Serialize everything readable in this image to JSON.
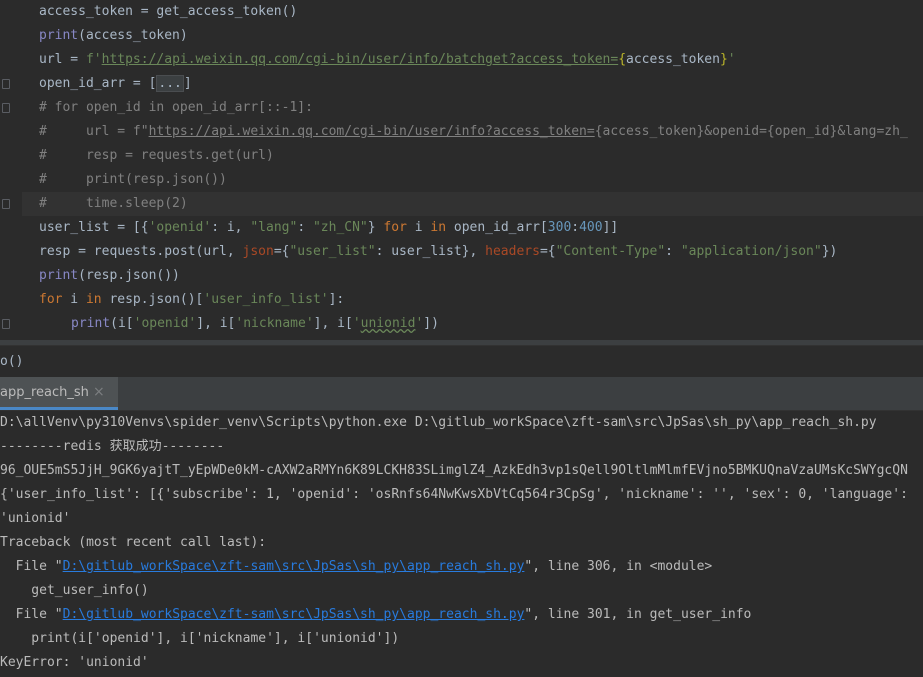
{
  "editor": {
    "line1": "access_token = get_access_token()",
    "line2": {
      "fn": "print",
      "rest": "(access_token)"
    },
    "line3": {
      "lhs": "url = ",
      "prefix": "f'",
      "url": "https://api.weixin.qq.com/cgi-bin/user/info/batchget?access_token=",
      "brace_open": "{",
      "var": "access_token",
      "brace_close": "}",
      "quote": "'"
    },
    "line4": {
      "lhs": "open_id_arr = [",
      "folded": "...",
      "rhs": "]"
    },
    "line5": "# for open_id in open_id_arr[::-1]:",
    "line6": {
      "hash": "#     url = f\"",
      "url": "https://api.weixin.qq.com/cgi-bin/user/info?access_token=",
      "rest": "{access_token}&openid={open_id}&lang=zh_"
    },
    "line7": "#     resp = requests.get(url)",
    "line8": "#     print(resp.json())",
    "line9": "#     time.sleep(2)",
    "line10": {
      "a": "user_list = [{",
      "k1": "'openid'",
      "b": ": i, ",
      "k2": "\"lang\"",
      "c": ": ",
      "v2": "\"zh_CN\"",
      "d": "} ",
      "for": "for",
      "e": " i ",
      "in": "in",
      "f": " open_id_arr[",
      "n1": "300",
      "g": ":",
      "n2": "400",
      "h": "]]"
    },
    "line11": {
      "a": "resp = requests.post(url, ",
      "p1": "json",
      "b": "={",
      "s1": "\"user_list\"",
      "c": ": user_list}, ",
      "p2": "headers",
      "d": "={",
      "s2": "\"Content-Type\"",
      "e": ": ",
      "s3": "\"application/json\"",
      "f": "})"
    },
    "line12": {
      "fn": "print",
      "rest": "(resp.json())"
    },
    "line13": {
      "for": "for",
      "a": " i ",
      "in": "in",
      "b": " resp.json()[",
      "s": "'user_info_list'",
      "c": "]:"
    },
    "line14": {
      "fn": "print",
      "a": "(i[",
      "s1": "'openid'",
      "b": "], i[",
      "s2": "'nickname'",
      "c": "], i[",
      "s3q": "'",
      "s3": "unionid",
      "s3e": "'",
      "d": "])"
    }
  },
  "breadcrumb": "o()",
  "run_tab": {
    "label": "app_reach_sh",
    "close": "×"
  },
  "console": {
    "lines": [
      "D:\\allVenv\\py310Venvs\\spider_venv\\Scripts\\python.exe D:\\gitlub_workSpace\\zft-sam\\src\\JpSas\\sh_py\\app_reach_sh.py",
      "--------redis 获取成功--------",
      "96_OUE5mS5JjH_9GK6yajtT_yEpWDe0kM-cAXW2aRMYn6K89LCKH83SLimglZ4_AzkEdh3vp1sQell9OltlmMlmfEVjno5BMKUQnaVzaUMsKcSWYgcQN",
      "{'user_info_list': [{'subscribe': 1, 'openid': 'osRnfs64NwKwsXbVtCq564r3CpSg', 'nickname': '', 'sex': 0, 'language':",
      "'unionid'",
      "Traceback (most recent call last):"
    ],
    "tb1": {
      "pre": "  File \"",
      "link": "D:\\gitlub_workSpace\\zft-sam\\src\\JpSas\\sh_py\\app_reach_sh.py",
      "post": "\", line 306, in <module>"
    },
    "tb1_code": "    get_user_info()",
    "tb2": {
      "pre": "  File \"",
      "link": "D:\\gitlub_workSpace\\zft-sam\\src\\JpSas\\sh_py\\app_reach_sh.py",
      "post": "\", line 301, in get_user_info"
    },
    "tb2_code": "    print(i['openid'], i['nickname'], i['unionid'])",
    "error": "KeyError: 'unionid'"
  }
}
